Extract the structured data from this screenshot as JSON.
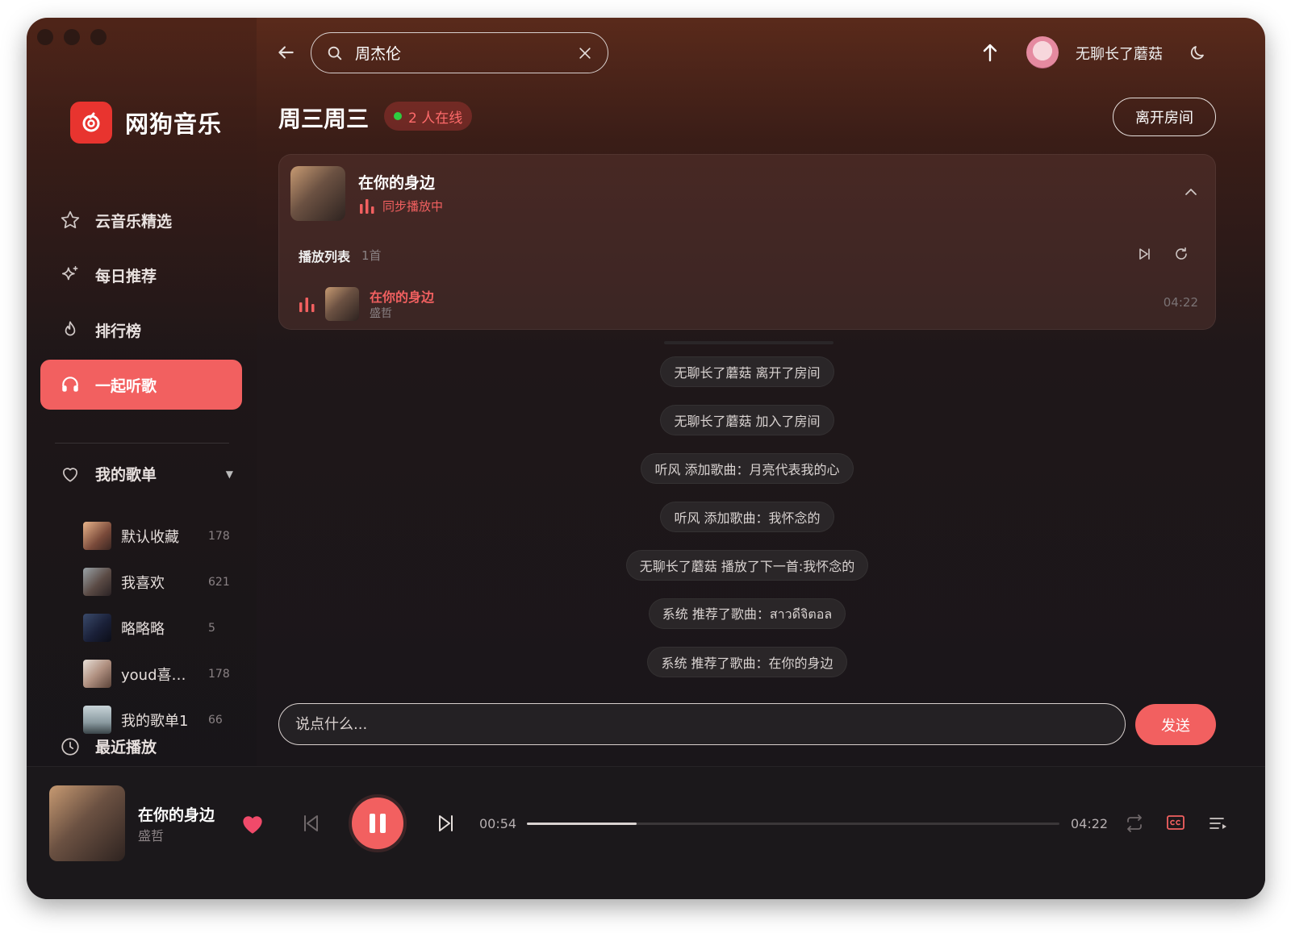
{
  "app": {
    "name": "网狗音乐"
  },
  "colors": {
    "accent": "#f26060",
    "online": "#2ecc40"
  },
  "sidebar": {
    "nav": [
      {
        "label": "云音乐精选",
        "icon": "star-icon"
      },
      {
        "label": "每日推荐",
        "icon": "sparkle-icon"
      },
      {
        "label": "排行榜",
        "icon": "flame-icon"
      },
      {
        "label": "一起听歌",
        "icon": "headphones-icon",
        "active": true
      }
    ],
    "my_playlists_label": "我的歌单",
    "playlists": [
      {
        "name": "默认收藏",
        "count": "178"
      },
      {
        "name": "我喜欢",
        "count": "621"
      },
      {
        "name": "略略略",
        "count": "5"
      },
      {
        "name": "youd喜…",
        "count": "178"
      },
      {
        "name": "我的歌单1",
        "count": "66"
      }
    ],
    "recent_label": "最近播放"
  },
  "header": {
    "search_value": "周杰伦",
    "username": "无聊长了蘑菇"
  },
  "room": {
    "title": "周三周三",
    "online": "2 人在线",
    "leave_label": "离开房间"
  },
  "now_playing_card": {
    "song": "在你的身边",
    "status": "同步播放中",
    "playlist_label": "播放列表",
    "playlist_count": "1首",
    "tracks": [
      {
        "name": "在你的身边",
        "artist": "盛哲",
        "duration": "04:22"
      }
    ]
  },
  "messages": [
    "无聊长了蘑菇 离开了房间",
    "无聊长了蘑菇 加入了房间",
    "听风 添加歌曲：月亮代表我的心",
    "听风 添加歌曲：我怀念的",
    "无聊长了蘑菇 播放了下一首:我怀念的",
    "系统 推荐了歌曲：สาวดีจิตอล",
    "系统 推荐了歌曲：在你的身边"
  ],
  "chat": {
    "placeholder": "说点什么...",
    "send_label": "发送"
  },
  "player": {
    "song": "在你的身边",
    "artist": "盛哲",
    "current_time": "00:54",
    "total_time": "04:22",
    "progress": 0.206,
    "liked": true,
    "state": "playing"
  }
}
